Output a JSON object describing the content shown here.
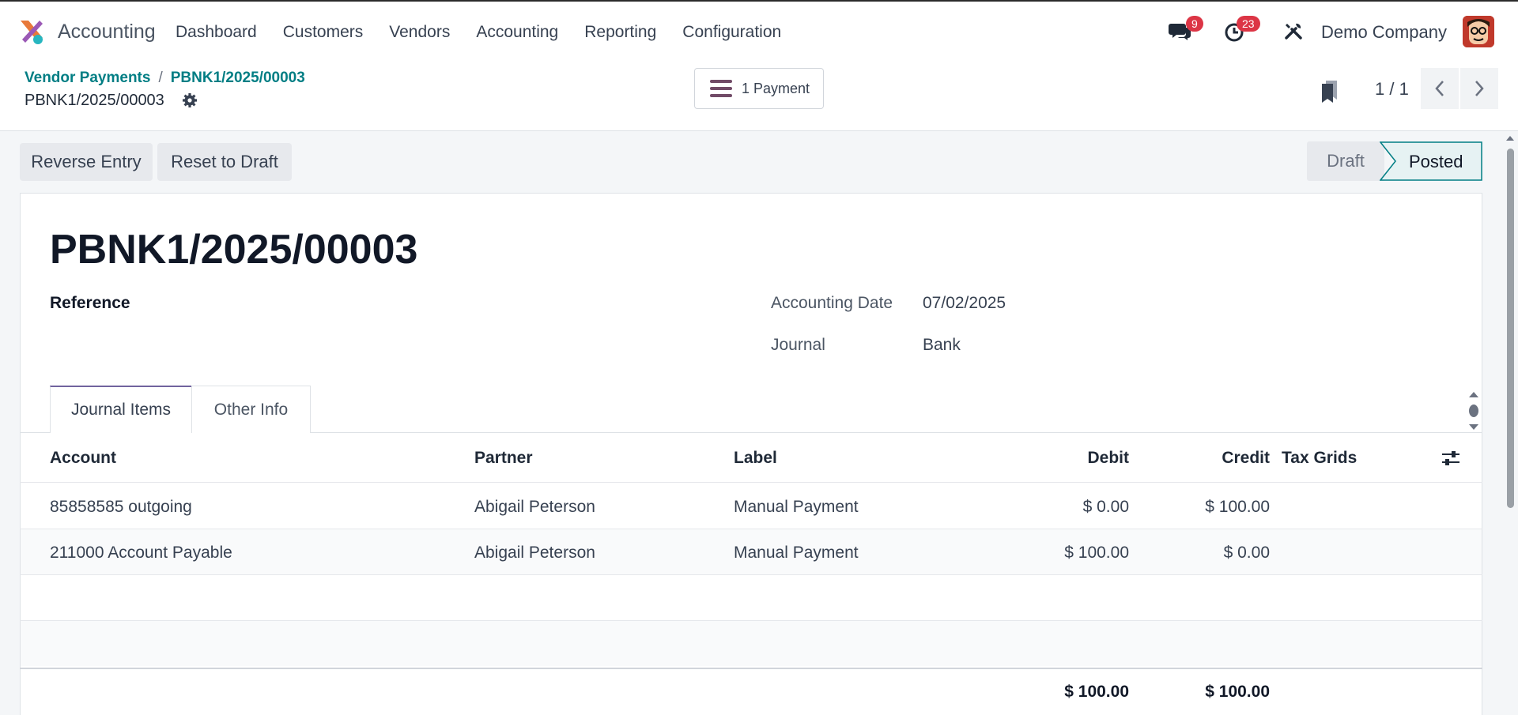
{
  "app": {
    "name": "Accounting"
  },
  "menu": [
    "Dashboard",
    "Customers",
    "Vendors",
    "Accounting",
    "Reporting",
    "Configuration"
  ],
  "systray": {
    "messages_count": "9",
    "activities_count": "23",
    "company": "Demo Company"
  },
  "breadcrumb": {
    "parent": "Vendor Payments",
    "sep": "/",
    "current": "PBNK1/2025/00003"
  },
  "record_name": "PBNK1/2025/00003",
  "smart_button": {
    "label": "1 Payment"
  },
  "pager": {
    "text": "1 / 1"
  },
  "actions": {
    "reverse": "Reverse Entry",
    "reset": "Reset to Draft"
  },
  "status": {
    "draft": "Draft",
    "posted": "Posted",
    "current": "Posted"
  },
  "form": {
    "title": "PBNK1/2025/00003",
    "reference_label": "Reference",
    "date_label": "Accounting Date",
    "date_value": "07/02/2025",
    "journal_label": "Journal",
    "journal_value": "Bank"
  },
  "tabs": [
    {
      "label": "Journal Items",
      "active": true
    },
    {
      "label": "Other Info",
      "active": false
    }
  ],
  "table": {
    "headers": {
      "account": "Account",
      "partner": "Partner",
      "label": "Label",
      "debit": "Debit",
      "credit": "Credit",
      "tax": "Tax Grids"
    },
    "rows": [
      {
        "account": "85858585 outgoing",
        "partner": "Abigail Peterson",
        "label": "Manual Payment",
        "debit": "$ 0.00",
        "credit": "$ 100.00"
      },
      {
        "account": "211000 Account Payable",
        "partner": "Abigail Peterson",
        "label": "Manual Payment",
        "debit": "$ 100.00",
        "credit": "$ 0.00"
      }
    ],
    "totals": {
      "debit": "$ 100.00",
      "credit": "$ 100.00"
    }
  },
  "colors": {
    "accent": "#017e84",
    "brand": "#71639e",
    "badge": "#dc3545"
  },
  "icons": [
    "app-logo",
    "chat-icon",
    "clock-icon",
    "tools-icon",
    "gear-icon",
    "hamburger-icon",
    "bookmark-icon",
    "chevron-left-icon",
    "chevron-right-icon",
    "optional-columns-icon",
    "scroll-indicator-icon"
  ]
}
